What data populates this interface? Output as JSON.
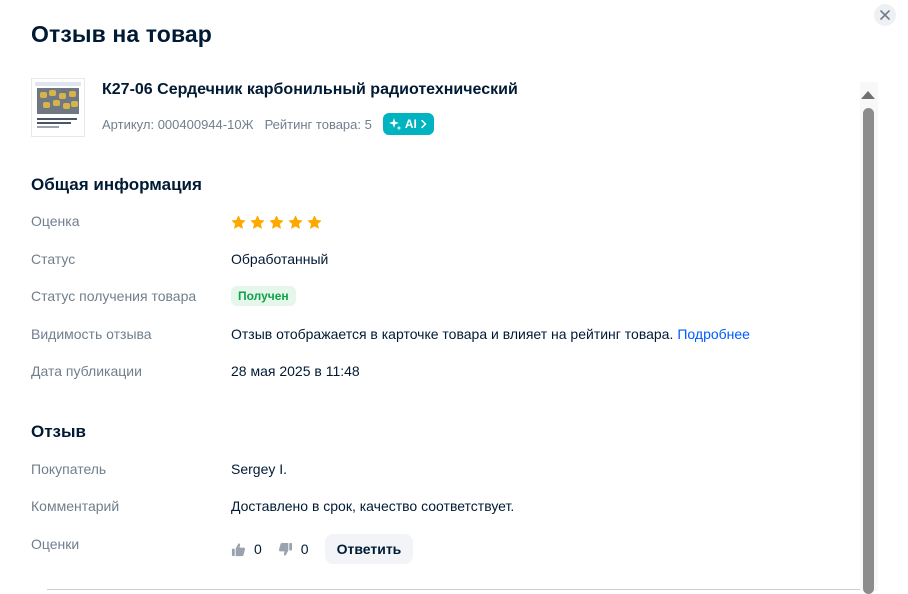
{
  "title": "Отзыв на товар",
  "close_icon": "close-icon",
  "product": {
    "name": "К27-06 Сердечник карбонильный радиотехнический",
    "article": "Артикул: 000400944-10Ж",
    "rating": "Рейтинг товара: 5",
    "ai_label": "AI",
    "ai_color": "#00b3c0"
  },
  "general": {
    "title": "Общая информация",
    "rating_label": "Оценка",
    "stars": 5,
    "star_color": "#ffa800",
    "status_label": "Статус",
    "status_value": "Обработанный",
    "receipt_label": "Статус получения товара",
    "receipt_value": "Получен",
    "visibility_label": "Видимость отзыва",
    "visibility_value": "Отзыв отображается в карточке товара и влияет на рейтинг товара.",
    "visibility_link": "Подробнее",
    "date_label": "Дата публикации",
    "date_value": "28 мая 2025 в 11:48"
  },
  "review": {
    "title": "Отзыв",
    "buyer_label": "Покупатель",
    "buyer_value": "Sergey I.",
    "comment_label": "Комментарий",
    "comment_value": "Доставлено в срок, качество соответствует.",
    "votes_label": "Оценки",
    "likes": "0",
    "dislikes": "0",
    "reply_label": "Ответить"
  }
}
